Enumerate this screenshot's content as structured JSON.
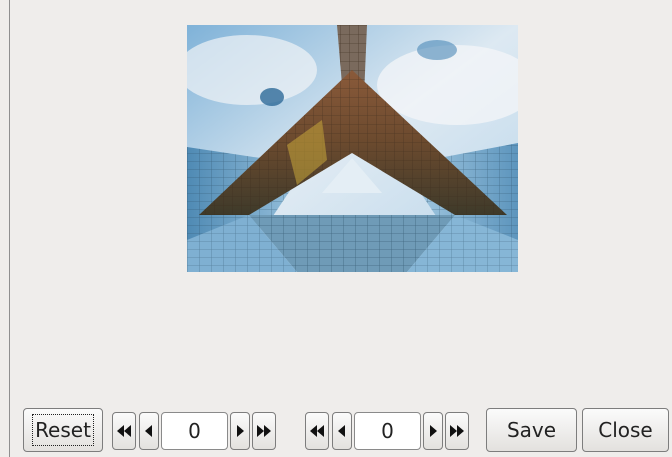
{
  "controls": {
    "reset_label": "Reset",
    "save_label": "Save",
    "close_label": "Close",
    "field_a_value": "0",
    "field_b_value": "0"
  },
  "icons": {
    "first": "first-icon",
    "prev": "prev-icon",
    "next": "next-icon",
    "last": "last-icon"
  }
}
